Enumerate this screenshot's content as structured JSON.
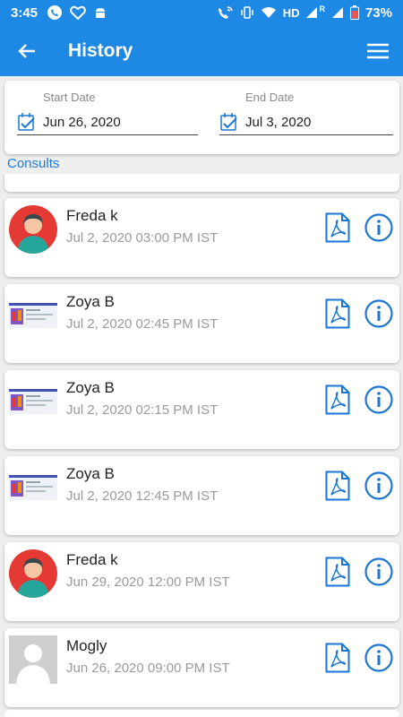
{
  "status_bar": {
    "time": "3:45",
    "left_icons": [
      "phone-icon",
      "heart-icon",
      "android-icon"
    ],
    "network": "HD",
    "signal_label": "R",
    "battery": "73%"
  },
  "app_bar": {
    "title": "History",
    "back_icon": "arrow-left-icon",
    "menu_icon": "hamburger-menu-icon"
  },
  "date_filter": {
    "start": {
      "label": "Start Date",
      "value": "Jun 26, 2020"
    },
    "end": {
      "label": "End Date",
      "value": "Jul 3, 2020"
    }
  },
  "section": {
    "label": "Consults"
  },
  "consults": [
    {
      "name": "Freda k",
      "datetime": "Jul 2, 2020 03:00 PM IST",
      "avatar": "avatar-woman-icon"
    },
    {
      "name": "Zoya B",
      "datetime": "Jul 2, 2020 02:45 PM IST",
      "avatar": "screenshot-thumbnail"
    },
    {
      "name": "Zoya B",
      "datetime": "Jul 2, 2020 02:15 PM IST",
      "avatar": "screenshot-thumbnail"
    },
    {
      "name": "Zoya B",
      "datetime": "Jul 2, 2020 12:45 PM IST",
      "avatar": "screenshot-thumbnail"
    },
    {
      "name": "Freda k",
      "datetime": "Jun 29, 2020 12:00 PM IST",
      "avatar": "avatar-woman-icon"
    },
    {
      "name": "Mogly",
      "datetime": "Jun 26, 2020 09:00 PM IST",
      "avatar": "avatar-placeholder-icon"
    }
  ],
  "colors": {
    "primary": "#1e88e5",
    "accent_icon": "#1976d2",
    "avatar_red": "#e53935"
  }
}
